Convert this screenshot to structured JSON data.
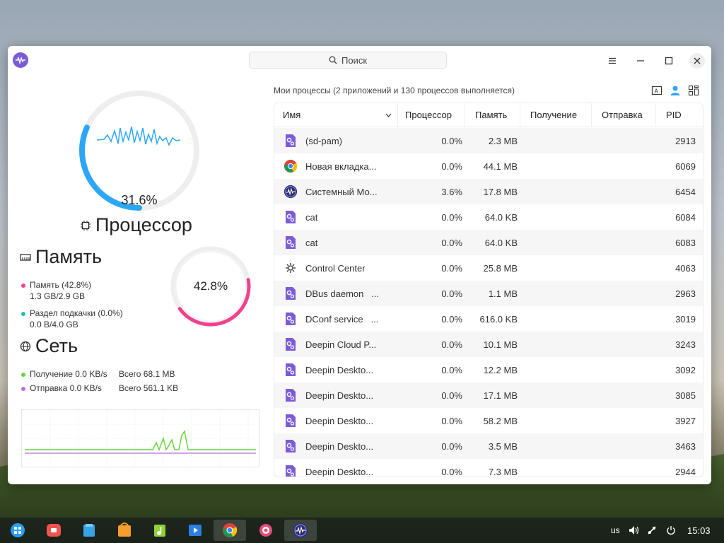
{
  "window": {
    "search_placeholder": "Поиск"
  },
  "cpu": {
    "percent_label": "31.6%",
    "title": "Процессор",
    "percent": 31.6
  },
  "memory": {
    "title": "Память",
    "mem_label": "Память (42.8%)",
    "mem_value": "1.3 GB/2.9 GB",
    "swap_label": "Раздел подкачки (0.0%)",
    "swap_value": "0.0 B/4.0 GB",
    "percent_label": "42.8%",
    "percent": 42.8
  },
  "network": {
    "title": "Сеть",
    "recv_label": "Получение 0.0 KB/s",
    "recv_total": "Всего 68.1 MB",
    "send_label": "Отправка 0.0 KB/s",
    "send_total": "Всего 561.1 KB"
  },
  "processes": {
    "summary": "Мои процессы (2 приложений и 130 процессов выполняется)",
    "columns": [
      "Имя",
      "Процессор",
      "Память",
      "Получение",
      "Отправка",
      "PID"
    ],
    "rows": [
      {
        "name": "(sd-pam)",
        "cpu": "0.0%",
        "mem": "2.3 MB",
        "pid": "2913",
        "icon": "gear-app-icon"
      },
      {
        "name": "Новая вкладка...",
        "cpu": "0.0%",
        "mem": "44.1 MB",
        "pid": "6069",
        "icon": "chrome-icon"
      },
      {
        "name": "Системный Мо...",
        "cpu": "3.6%",
        "mem": "17.8 MB",
        "pid": "6454",
        "icon": "system-monitor-icon"
      },
      {
        "name": "cat",
        "cpu": "0.0%",
        "mem": "64.0 KB",
        "pid": "6084",
        "icon": "gear-app-icon"
      },
      {
        "name": "cat",
        "cpu": "0.0%",
        "mem": "64.0 KB",
        "pid": "6083",
        "icon": "gear-app-icon"
      },
      {
        "name": "Control Center",
        "cpu": "0.0%",
        "mem": "25.8 MB",
        "pid": "4063",
        "icon": "settings-icon"
      },
      {
        "name": "DBus daemon   ...",
        "cpu": "0.0%",
        "mem": "1.1 MB",
        "pid": "2963",
        "icon": "gear-app-icon"
      },
      {
        "name": "DConf service   ...",
        "cpu": "0.0%",
        "mem": "616.0 KB",
        "pid": "3019",
        "icon": "gear-app-icon"
      },
      {
        "name": "Deepin Cloud P...",
        "cpu": "0.0%",
        "mem": "10.1 MB",
        "pid": "3243",
        "icon": "gear-app-icon"
      },
      {
        "name": "Deepin Deskto...",
        "cpu": "0.0%",
        "mem": "12.2 MB",
        "pid": "3092",
        "icon": "gear-app-icon"
      },
      {
        "name": "Deepin Deskto...",
        "cpu": "0.0%",
        "mem": "17.1 MB",
        "pid": "3085",
        "icon": "gear-app-icon"
      },
      {
        "name": "Deepin Deskto...",
        "cpu": "0.0%",
        "mem": "58.2 MB",
        "pid": "3927",
        "icon": "gear-app-icon"
      },
      {
        "name": "Deepin Deskto...",
        "cpu": "0.0%",
        "mem": "3.5 MB",
        "pid": "3463",
        "icon": "gear-app-icon"
      },
      {
        "name": "Deepin Deskto...",
        "cpu": "0.0%",
        "mem": "7.3 MB",
        "pid": "2944",
        "icon": "gear-app-icon"
      }
    ]
  },
  "taskbar": {
    "lang": "us",
    "time": "15:03"
  },
  "colors": {
    "cpu_ring": "#2ca7f8",
    "mem_ring": "#f0428c",
    "recv_line": "#6bd23c",
    "send_line": "#b86fe0",
    "proc_icon": "#7b5cd6"
  }
}
